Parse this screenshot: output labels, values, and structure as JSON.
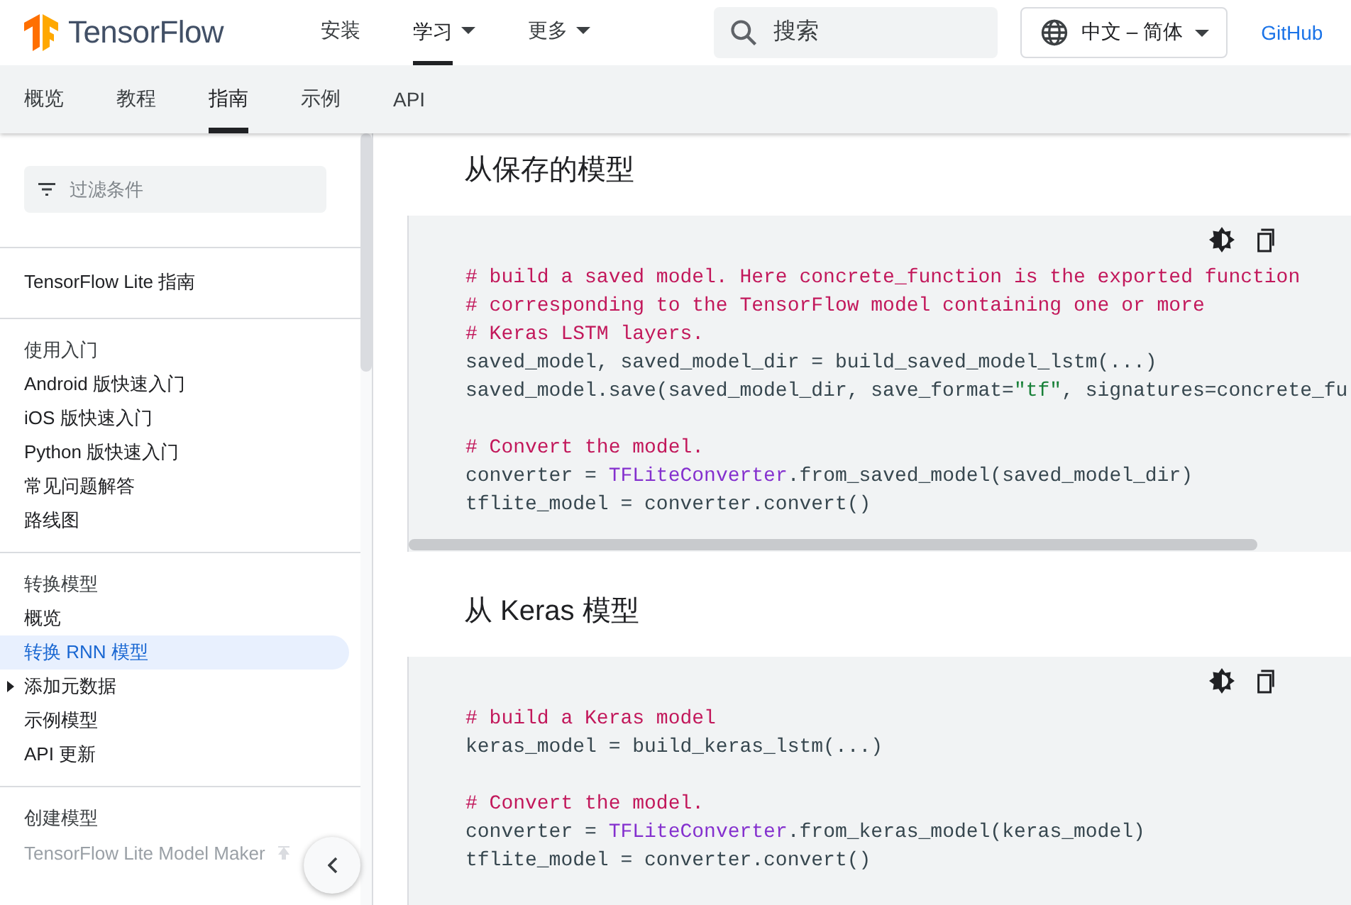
{
  "header": {
    "logo": "TensorFlow",
    "nav": [
      {
        "label": "安装",
        "selected": false,
        "dropdown": false
      },
      {
        "label": "学习",
        "selected": true,
        "dropdown": true
      },
      {
        "label": "更多",
        "selected": false,
        "dropdown": true
      }
    ],
    "search": {
      "placeholder": "搜索"
    },
    "language": "中文 – 简体",
    "github": "GitHub"
  },
  "tabs": [
    {
      "label": "概览",
      "selected": false
    },
    {
      "label": "教程",
      "selected": false
    },
    {
      "label": "指南",
      "selected": true
    },
    {
      "label": "示例",
      "selected": false
    },
    {
      "label": "API",
      "selected": false
    }
  ],
  "sidebar": {
    "filter": {
      "placeholder": "过滤条件"
    },
    "sections": [
      {
        "items": [
          {
            "label": "TensorFlow Lite 指南",
            "kind": "link",
            "selected": false
          }
        ]
      },
      {
        "items": [
          {
            "label": "使用入门",
            "kind": "heading",
            "selected": false
          },
          {
            "label": "Android 版快速入门",
            "kind": "link",
            "selected": false
          },
          {
            "label": "iOS 版快速入门",
            "kind": "link",
            "selected": false
          },
          {
            "label": "Python 版快速入门",
            "kind": "link",
            "selected": false
          },
          {
            "label": "常见问题解答",
            "kind": "link",
            "selected": false
          },
          {
            "label": "路线图",
            "kind": "link",
            "selected": false
          }
        ]
      },
      {
        "items": [
          {
            "label": "转换模型",
            "kind": "heading",
            "selected": false
          },
          {
            "label": "概览",
            "kind": "link",
            "selected": false
          },
          {
            "label": "转换 RNN 模型",
            "kind": "link",
            "selected": true
          },
          {
            "label": "添加元数据",
            "kind": "folder",
            "selected": false
          },
          {
            "label": "示例模型",
            "kind": "link",
            "selected": false
          },
          {
            "label": "API 更新",
            "kind": "link",
            "selected": false
          }
        ]
      },
      {
        "items": [
          {
            "label": "创建模型",
            "kind": "heading",
            "selected": false
          },
          {
            "label": "TensorFlow Lite Model Maker",
            "kind": "faded",
            "selected": false
          }
        ]
      }
    ]
  },
  "content": [
    {
      "heading": "从保存的模型",
      "scrollbar": true,
      "lines": [
        {
          "tokens": [
            {
              "kind": "comment",
              "text": "# build a saved model. Here concrete_function is the exported function"
            }
          ]
        },
        {
          "tokens": [
            {
              "kind": "comment",
              "text": "# corresponding to the TensorFlow model containing one or more"
            }
          ]
        },
        {
          "tokens": [
            {
              "kind": "comment",
              "text": "# Keras LSTM layers."
            }
          ]
        },
        {
          "tokens": [
            {
              "kind": "plain",
              "text": "saved_model, saved_model_dir = build_saved_model_lstm(...)"
            }
          ]
        },
        {
          "tokens": [
            {
              "kind": "plain",
              "text": "saved_model.save(saved_model_dir, save_format="
            },
            {
              "kind": "string",
              "text": "\"tf\""
            },
            {
              "kind": "plain",
              "text": ", signatures=concrete_fu"
            }
          ]
        },
        {
          "kind": "blank"
        },
        {
          "tokens": [
            {
              "kind": "comment",
              "text": "# Convert the model."
            }
          ]
        },
        {
          "tokens": [
            {
              "kind": "plain",
              "text": "converter = "
            },
            {
              "kind": "type",
              "text": "TFLiteConverter"
            },
            {
              "kind": "plain",
              "text": ".from_saved_model(saved_model_dir)"
            }
          ]
        },
        {
          "tokens": [
            {
              "kind": "plain",
              "text": "tflite_model = converter.convert()"
            }
          ]
        }
      ]
    },
    {
      "heading": "从 Keras 模型",
      "scrollbar": false,
      "lines": [
        {
          "tokens": [
            {
              "kind": "comment",
              "text": "# build a Keras model"
            }
          ]
        },
        {
          "tokens": [
            {
              "kind": "plain",
              "text": "keras_model = build_keras_lstm(...)"
            }
          ]
        },
        {
          "kind": "blank"
        },
        {
          "tokens": [
            {
              "kind": "comment",
              "text": "# Convert the model."
            }
          ]
        },
        {
          "tokens": [
            {
              "kind": "plain",
              "text": "converter = "
            },
            {
              "kind": "type",
              "text": "TFLiteConverter"
            },
            {
              "kind": "plain",
              "text": ".from_keras_model(keras_model)"
            }
          ]
        },
        {
          "tokens": [
            {
              "kind": "plain",
              "text": "tflite_model = converter.convert()"
            }
          ]
        }
      ]
    }
  ]
}
